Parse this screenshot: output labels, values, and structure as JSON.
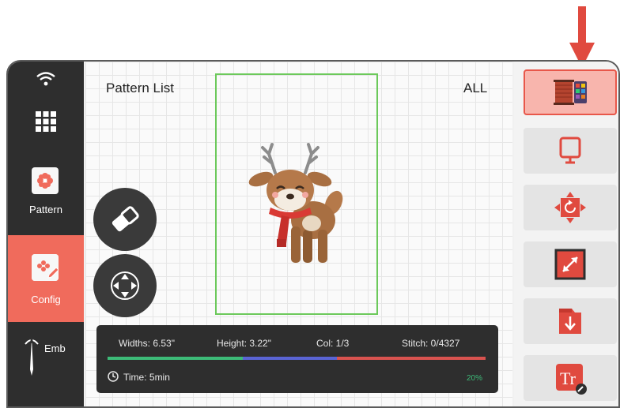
{
  "sidebar": {
    "items": [
      {
        "icon": "wifi-icon"
      },
      {
        "icon": "apps-grid-icon"
      },
      {
        "label": "Pattern",
        "icon": "pattern-icon"
      },
      {
        "label": "Config",
        "icon": "config-icon",
        "active": true
      },
      {
        "label": "Emb",
        "icon": "needle-icon"
      }
    ]
  },
  "main": {
    "title": "Pattern List",
    "filter": "ALL",
    "design": "reindeer-embroidery",
    "fabs": [
      {
        "icon": "eraser-icon"
      },
      {
        "icon": "move-arrows-icon"
      }
    ]
  },
  "info": {
    "width": "Widths: 6.53\"",
    "height": "Height: 3.22\"",
    "color": "Col: 1/3",
    "stitch": "Stitch: 0/4327",
    "time": "Time: 5min",
    "percent": "20%",
    "progress": 0.2,
    "color_segments": [
      "#3dbb78",
      "#5a64d4",
      "#d9534f"
    ]
  },
  "right_panel": {
    "buttons": [
      {
        "icon": "thread-color-icon",
        "selected": true
      },
      {
        "icon": "hoop-frame-icon"
      },
      {
        "icon": "rotate-icon"
      },
      {
        "icon": "resize-icon"
      },
      {
        "icon": "import-icon"
      },
      {
        "icon": "text-tool-icon"
      }
    ]
  },
  "colors": {
    "accent": "#f06b5c",
    "dark": "#2e2e2e",
    "hoop": "#6cc95b",
    "arrow": "#e04a3f"
  }
}
